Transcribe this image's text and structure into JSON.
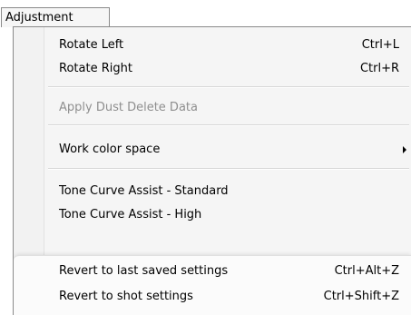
{
  "menubar": {
    "title": "Adjustment"
  },
  "menu": {
    "items": [
      {
        "label": "Rotate Left",
        "shortcut": "Ctrl+L"
      },
      {
        "label": "Rotate Right",
        "shortcut": "Ctrl+R"
      },
      {
        "label": "Apply Dust Delete Data",
        "disabled": true
      },
      {
        "label": "Work color space",
        "submenu": true
      },
      {
        "label": "Tone Curve Assist - Standard"
      },
      {
        "label": "Tone Curve Assist - High"
      },
      {
        "label": "Revert to last saved settings",
        "shortcut": "Ctrl+Alt+Z"
      },
      {
        "label": "Revert to shot settings",
        "shortcut": "Ctrl+Shift+Z"
      }
    ]
  },
  "icons": {
    "submenu_arrow": "chevron-right-icon"
  }
}
